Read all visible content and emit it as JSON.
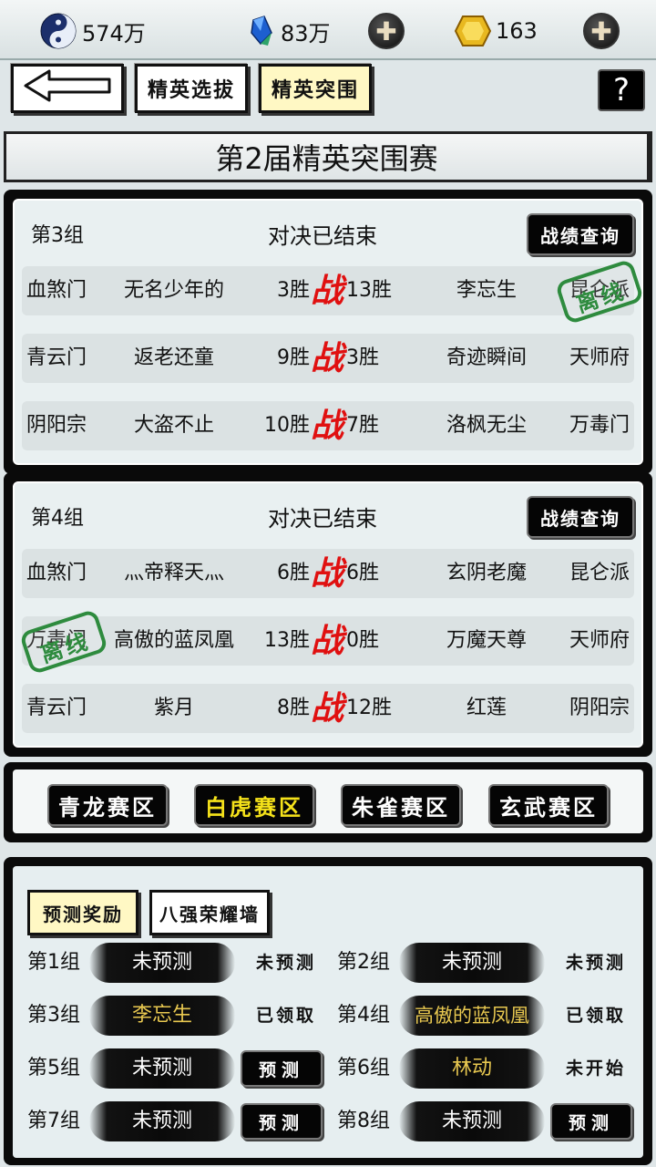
{
  "resources": {
    "taiji": {
      "icon": "yin-yang-icon",
      "value": "574万"
    },
    "crystal": {
      "icon": "blue-crystal-icon",
      "value": "83万"
    },
    "gold": {
      "icon": "gold-ingot-icon",
      "value": "163"
    },
    "plus_icon": "plus-icon"
  },
  "nav": {
    "back_icon": "back-arrow-icon",
    "tab_selection": "精英选拔",
    "tab_breakout": "精英突围",
    "help": "?"
  },
  "banner_title": "第2届精英突围赛",
  "groups": [
    {
      "name": "第3组",
      "status": "对决已结束",
      "record_button": "战绩查询",
      "matches": [
        {
          "sect_left": "血煞门",
          "player_left": "无名少年的",
          "wins_left": "3胜",
          "vs": "战",
          "wins_right": "13胜",
          "player_right": "李忘生",
          "sect_right": "昆仑派",
          "offline_stamp": "right",
          "stamp_text": "离线"
        },
        {
          "sect_left": "青云门",
          "player_left": "返老还童",
          "wins_left": "9胜",
          "vs": "战",
          "wins_right": "3胜",
          "player_right": "奇迹瞬间",
          "sect_right": "天师府"
        },
        {
          "sect_left": "阴阳宗",
          "player_left": "大盗不止",
          "wins_left": "10胜",
          "vs": "战",
          "wins_right": "7胜",
          "player_right": "洛枫无尘",
          "sect_right": "万毒门"
        }
      ]
    },
    {
      "name": "第4组",
      "status": "对决已结束",
      "record_button": "战绩查询",
      "matches": [
        {
          "sect_left": "血煞门",
          "player_left": "灬帝释天灬",
          "wins_left": "6胜",
          "vs": "战",
          "wins_right": "6胜",
          "player_right": "玄阴老魔",
          "sect_right": "昆仑派"
        },
        {
          "sect_left": "万毒门",
          "player_left": "高傲的蓝凤凰",
          "wins_left": "13胜",
          "vs": "战",
          "wins_right": "0胜",
          "player_right": "万魔天尊",
          "sect_right": "天师府",
          "offline_stamp": "left",
          "stamp_text": "离线"
        },
        {
          "sect_left": "青云门",
          "player_left": "紫月",
          "wins_left": "8胜",
          "vs": "战",
          "wins_right": "12胜",
          "player_right": "红莲",
          "sect_right": "阴阳宗"
        }
      ]
    }
  ],
  "regions": [
    "青龙赛区",
    "白虎赛区",
    "朱雀赛区",
    "玄武赛区"
  ],
  "active_region": 1,
  "prediction": {
    "tab_reward": "预测奖励",
    "tab_wall": "八强荣耀墙",
    "rows": [
      [
        {
          "label": "第1组",
          "pick": "未预测",
          "gold": false,
          "status": "未预测",
          "button": false
        },
        {
          "label": "第2组",
          "pick": "未预测",
          "gold": false,
          "status": "未预测",
          "button": false
        }
      ],
      [
        {
          "label": "第3组",
          "pick": "李忘生",
          "gold": true,
          "status": "已领取",
          "button": false
        },
        {
          "label": "第4组",
          "pick": "高傲的蓝凤凰",
          "gold": true,
          "status": "已领取",
          "button": false
        }
      ],
      [
        {
          "label": "第5组",
          "pick": "未预测",
          "gold": false,
          "status": "预测",
          "button": true
        },
        {
          "label": "第6组",
          "pick": "林动",
          "gold": true,
          "status": "未开始",
          "button": false
        }
      ],
      [
        {
          "label": "第7组",
          "pick": "未预测",
          "gold": false,
          "status": "预测",
          "button": true
        },
        {
          "label": "第8组",
          "pick": "未预测",
          "gold": false,
          "status": "预测",
          "button": true
        }
      ]
    ]
  },
  "colors": {
    "vs": "#e01010",
    "stamp": "#2e8b3e",
    "gold_text": "#e8c850",
    "active_region": "#f5e21a"
  }
}
